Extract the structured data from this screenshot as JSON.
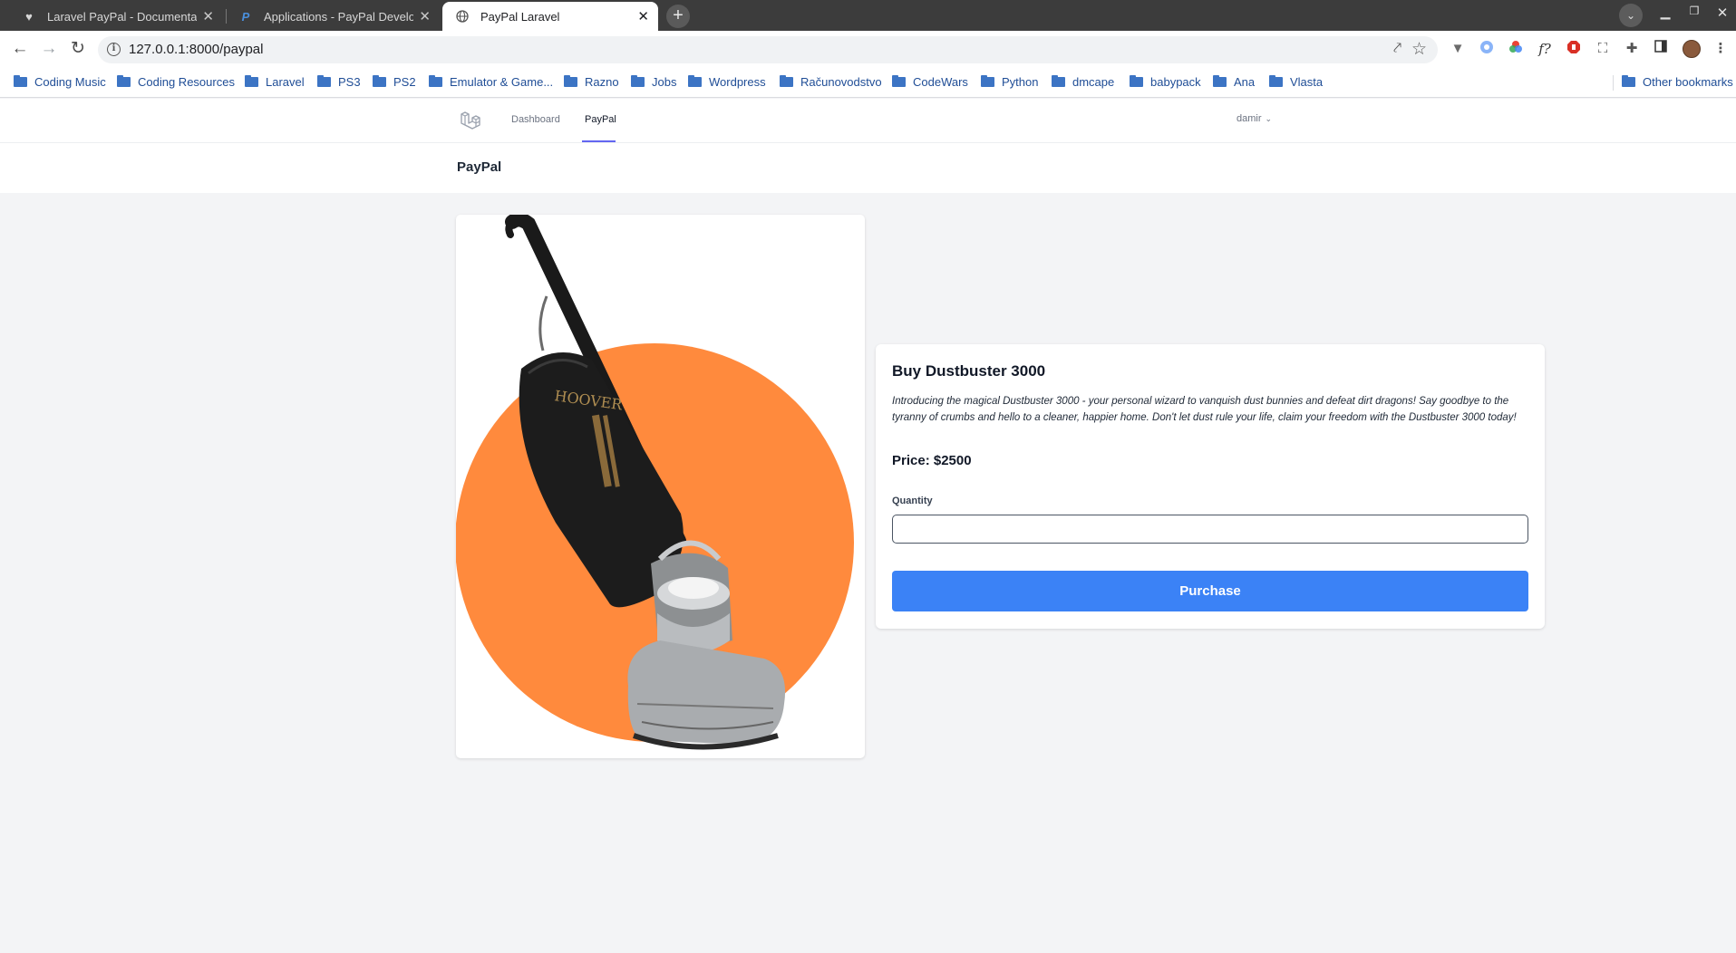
{
  "browser": {
    "tabs": [
      {
        "title": "Laravel PayPal - Documentation",
        "icon": "heart-icon"
      },
      {
        "title": "Applications - PayPal Developer",
        "icon": "paypal-icon"
      },
      {
        "title": "PayPal Laravel",
        "icon": "globe-icon",
        "active": true
      }
    ],
    "url": "127.0.0.1:8000/paypal",
    "bookmarks": [
      "Coding Music",
      "Coding Resources",
      "Laravel",
      "PS3",
      "PS2",
      "Emulator & Game...",
      "Razno",
      "Jobs",
      "Wordpress",
      "Računovodstvo",
      "CodeWars",
      "Python",
      "dmcape",
      "babypack",
      "Ana",
      "Vlasta"
    ],
    "other_bookmarks": "Other bookmarks"
  },
  "app": {
    "nav": {
      "dashboard": "Dashboard",
      "paypal": "PayPal"
    },
    "user": "damir",
    "header_title": "PayPal"
  },
  "product": {
    "title": "Buy Dustbuster 3000",
    "description": "Introducing the magical Dustbuster 3000 - your personal wizard to vanquish dust bunnies and defeat dirt dragons! Say goodbye to the tyranny of crumbs and hello to a cleaner, happier home. Don't let dust rule your life, claim your freedom with the Dustbuster 3000 today!",
    "price": "Price: $2500",
    "quantity_label": "Quantity",
    "quantity_value": "",
    "purchase_label": "Purchase",
    "image_brand": "The HOOVER"
  },
  "colors": {
    "accent": "#3b82f6",
    "nav_underline": "#6366f1",
    "product_circle": "#ff8a3d"
  }
}
